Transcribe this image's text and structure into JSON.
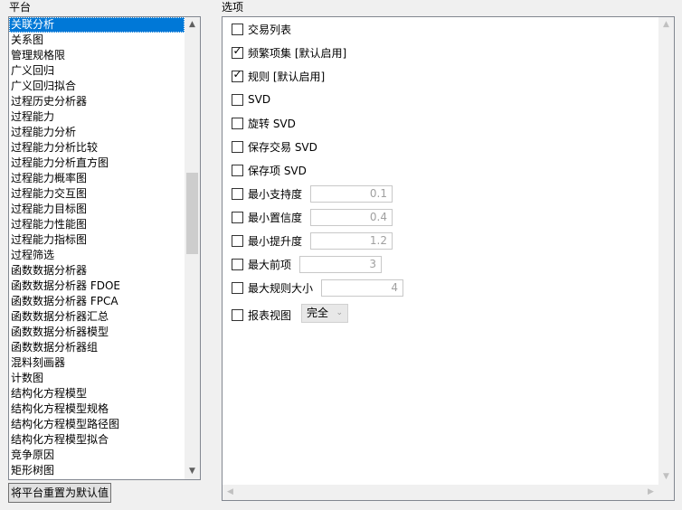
{
  "labels": {
    "platform": "平台",
    "options": "选项"
  },
  "platform_list": {
    "selected_index": 0,
    "items": [
      "关联分析",
      "关系图",
      "管理规格限",
      "广义回归",
      "广义回归拟合",
      "过程历史分析器",
      "过程能力",
      "过程能力分析",
      "过程能力分析比较",
      "过程能力分析直方图",
      "过程能力概率图",
      "过程能力交互图",
      "过程能力目标图",
      "过程能力性能图",
      "过程能力指标图",
      "过程筛选",
      "函数数据分析器",
      "函数数据分析器 FDOE",
      "函数数据分析器 FPCA",
      "函数数据分析器汇总",
      "函数数据分析器模型",
      "函数数据分析器组",
      "混料刻画器",
      "计数图",
      "结构化方程模型",
      "结构化方程模型规格",
      "结构化方程模型路径图",
      "结构化方程模型拟合",
      "竞争原因",
      "矩形树图"
    ]
  },
  "reset_button": "将平台重置为默认值",
  "options": {
    "transaction_list": {
      "label": "交易列表",
      "checked": false
    },
    "frequent_itemsets": {
      "label": "频繁项集 [默认启用]",
      "checked": true
    },
    "rules": {
      "label": "规则 [默认启用]",
      "checked": true
    },
    "svd": {
      "label": "SVD",
      "checked": false
    },
    "rotated_svd": {
      "label": "旋转 SVD",
      "checked": false
    },
    "save_transaction_svd": {
      "label": "保存交易 SVD",
      "checked": false
    },
    "save_item_svd": {
      "label": "保存项 SVD",
      "checked": false
    },
    "min_support": {
      "label": "最小支持度",
      "checked": false,
      "value": "0.1"
    },
    "min_confidence": {
      "label": "最小置信度",
      "checked": false,
      "value": "0.4"
    },
    "min_lift": {
      "label": "最小提升度",
      "checked": false,
      "value": "1.2"
    },
    "max_antecedents": {
      "label": "最大前项",
      "checked": false,
      "value": "3"
    },
    "max_rule_size": {
      "label": "最大规则大小",
      "checked": false,
      "value": "4"
    },
    "report_view": {
      "label": "报表视图",
      "checked": false,
      "value": "完全"
    }
  },
  "icons": {
    "scroll_up": "chevron-up-icon",
    "scroll_down": "chevron-down-icon",
    "checkmark": "checkmark-icon",
    "dropdown": "chevron-down-icon"
  },
  "colors": {
    "selection": "#0078d7",
    "disabled_text": "#a0a0a0"
  }
}
